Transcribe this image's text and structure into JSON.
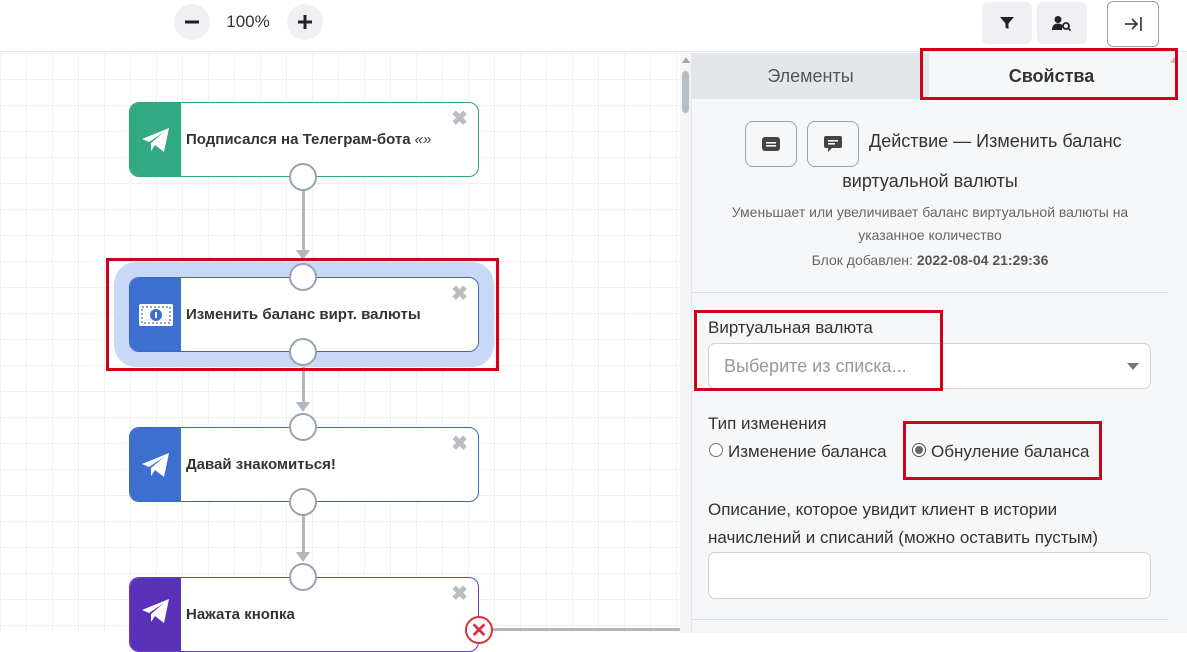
{
  "toolbar": {
    "zoom_out_icon": "minus-icon",
    "zoom_level": "100%",
    "zoom_in_icon": "plus-icon",
    "filter_icon": "filter-icon",
    "user_search_icon": "user-search-icon",
    "collapse_panel_icon": "collapse-right-icon"
  },
  "canvas": {
    "nodes": [
      {
        "title": "Подписался на Телеграм-бота",
        "title_suffix": "«»",
        "icon": "telegram-icon",
        "color": "#31a982"
      },
      {
        "title": "Изменить баланс вирт. валюты",
        "icon": "money-bill-icon",
        "color": "#3d6fd1",
        "selected": true
      },
      {
        "title": "Давай знакомиться!",
        "icon": "telegram-icon",
        "color": "#3d6fd1"
      },
      {
        "title": "Нажата кнопка",
        "icon": "telegram-icon",
        "color": "#5a32b8"
      }
    ],
    "close_glyph": "✖",
    "error_glyph": "✕"
  },
  "panel": {
    "tabs": [
      {
        "label": "Элементы",
        "active": false
      },
      {
        "label": "Свойства",
        "active": true
      }
    ],
    "action_title_line1": "Действие — Изменить баланс",
    "action_title_line2": "виртуальной валюты",
    "action_description": "Уменьшает или увеличивает баланс виртуальной валюты на указанное количество",
    "added_label": "Блок добавлен:",
    "added_value": "2022-08-04 21:29:36",
    "currency": {
      "label": "Виртуальная валюта",
      "placeholder": "Выберите из списка..."
    },
    "change_type": {
      "label": "Тип изменения",
      "options": [
        {
          "label": "Изменение баланса",
          "checked": false
        },
        {
          "label": "Обнуление баланса",
          "checked": true
        }
      ]
    },
    "client_description": {
      "label_line1": "Описание, которое увидит клиент в истории",
      "label_line2": "начислений и списаний (можно оставить пустым)",
      "value": ""
    }
  },
  "colors": {
    "highlight": "#d0021b",
    "selected_halo": "#c9d8f7"
  }
}
